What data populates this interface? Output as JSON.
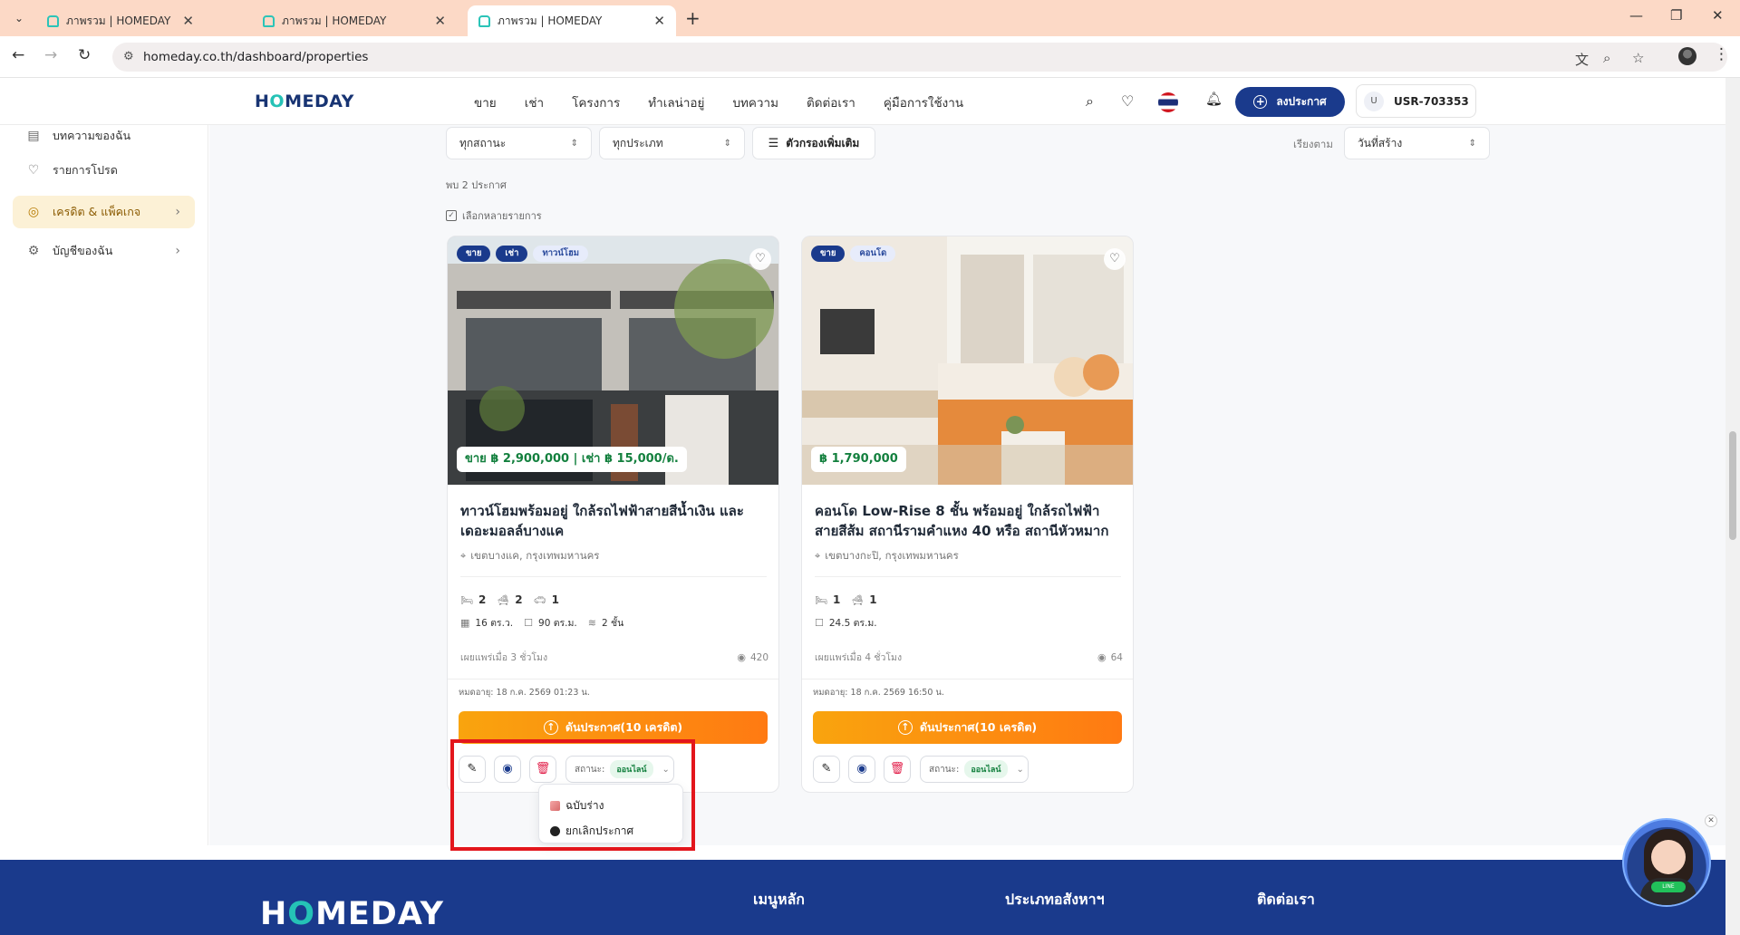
{
  "browser": {
    "tabs": [
      {
        "title": "ภาพรวม | HOMEDAY"
      },
      {
        "title": "ภาพรวม | HOMEDAY"
      },
      {
        "title": "ภาพรวม | HOMEDAY"
      }
    ],
    "url": "homeday.co.th/dashboard/properties"
  },
  "header": {
    "logo": {
      "pre": "H",
      "o": "O",
      "post": "MEDAY"
    },
    "nav": [
      "ขาย",
      "เช่า",
      "โครงการ",
      "ทำเลน่าอยู่",
      "บทความ",
      "ติดต่อเรา",
      "คู่มือการใช้งาน"
    ],
    "post_button": "ลงประกาศ",
    "user_initial": "U",
    "user_id": "USR-703353"
  },
  "sidebar": {
    "items": [
      {
        "label": "บทความของฉัน",
        "icon": "document-icon"
      },
      {
        "label": "รายการโปรด",
        "icon": "heart-icon"
      },
      {
        "label": "เครดิต & แพ็คเกจ",
        "icon": "coins-icon",
        "active": true
      },
      {
        "label": "บัญชีของฉัน",
        "icon": "gear-icon"
      }
    ]
  },
  "filters": {
    "status": "ทุกสถานะ",
    "type": "ทุกประเภท",
    "more": "ตัวกรองเพิ่มเติม",
    "sort_label": "เรียงตาม",
    "sort_value": "วันที่สร้าง"
  },
  "results": {
    "found": "พบ 2 ประกาศ",
    "multi_select": "เลือกหลายรายการ"
  },
  "listings": [
    {
      "badges": [
        "ขาย",
        "เช่า",
        "ทาวน์โฮม"
      ],
      "price": "ขาย ฿ 2,900,000 | เช่า ฿ 15,000/ด.",
      "title": "ทาวน์โฮมพร้อมอยู่ ใกล้รถไฟฟ้าสายสีน้ำเงิน และเดอะมอลล์บางแค",
      "location": "เขตบางแค, กรุงเทพมหานคร",
      "beds": "2",
      "baths": "2",
      "parking": "1",
      "land": "16 ตร.ว.",
      "area": "90 ตร.ม.",
      "floors": "2 ชั้น",
      "published": "เผยแพร่เมื่อ 3 ชั่วโมง",
      "views": "420",
      "expire": "หมดอายุ: 18 ก.ค. 2569 01:23 น.",
      "boost": "ดันประกาศ(10 เครดิต)",
      "status_label": "สถานะ:",
      "status_value": "ออนไลน์"
    },
    {
      "badges": [
        "ขาย",
        "คอนโด"
      ],
      "price": "฿ 1,790,000",
      "title": "คอนโด Low-Rise 8 ชั้น พร้อมอยู่ ใกล้รถไฟฟ้าสายสีส้ม สถานีรามคำแหง 40 หรือ สถานีหัวหมาก",
      "location": "เขตบางกะปิ, กรุงเทพมหานคร",
      "beds": "1",
      "baths": "1",
      "area": "24.5 ตร.ม.",
      "published": "เผยแพร่เมื่อ 4 ชั่วโมง",
      "views": "64",
      "expire": "หมดอายุ: 18 ก.ค. 2569 16:50 น.",
      "boost": "ดันประกาศ(10 เครดิต)",
      "status_label": "สถานะ:",
      "status_value": "ออนไลน์"
    }
  ],
  "status_menu": {
    "options": [
      "ฉบับร่าง",
      "ยกเลิกประกาศ"
    ]
  },
  "footer": {
    "logo": {
      "pre": "H",
      "o": "O",
      "post": "MEDAY"
    },
    "col1": "เมนูหลัก",
    "col2": "ประเภทอสังหาฯ",
    "col3": "ติดต่อเรา"
  },
  "colors": {
    "brand_navy": "#1a3a8c",
    "brand_teal": "#25c2b6",
    "boost_orange": "#ff8a12",
    "price_green": "#13803e",
    "highlight_red": "#e3161c"
  }
}
